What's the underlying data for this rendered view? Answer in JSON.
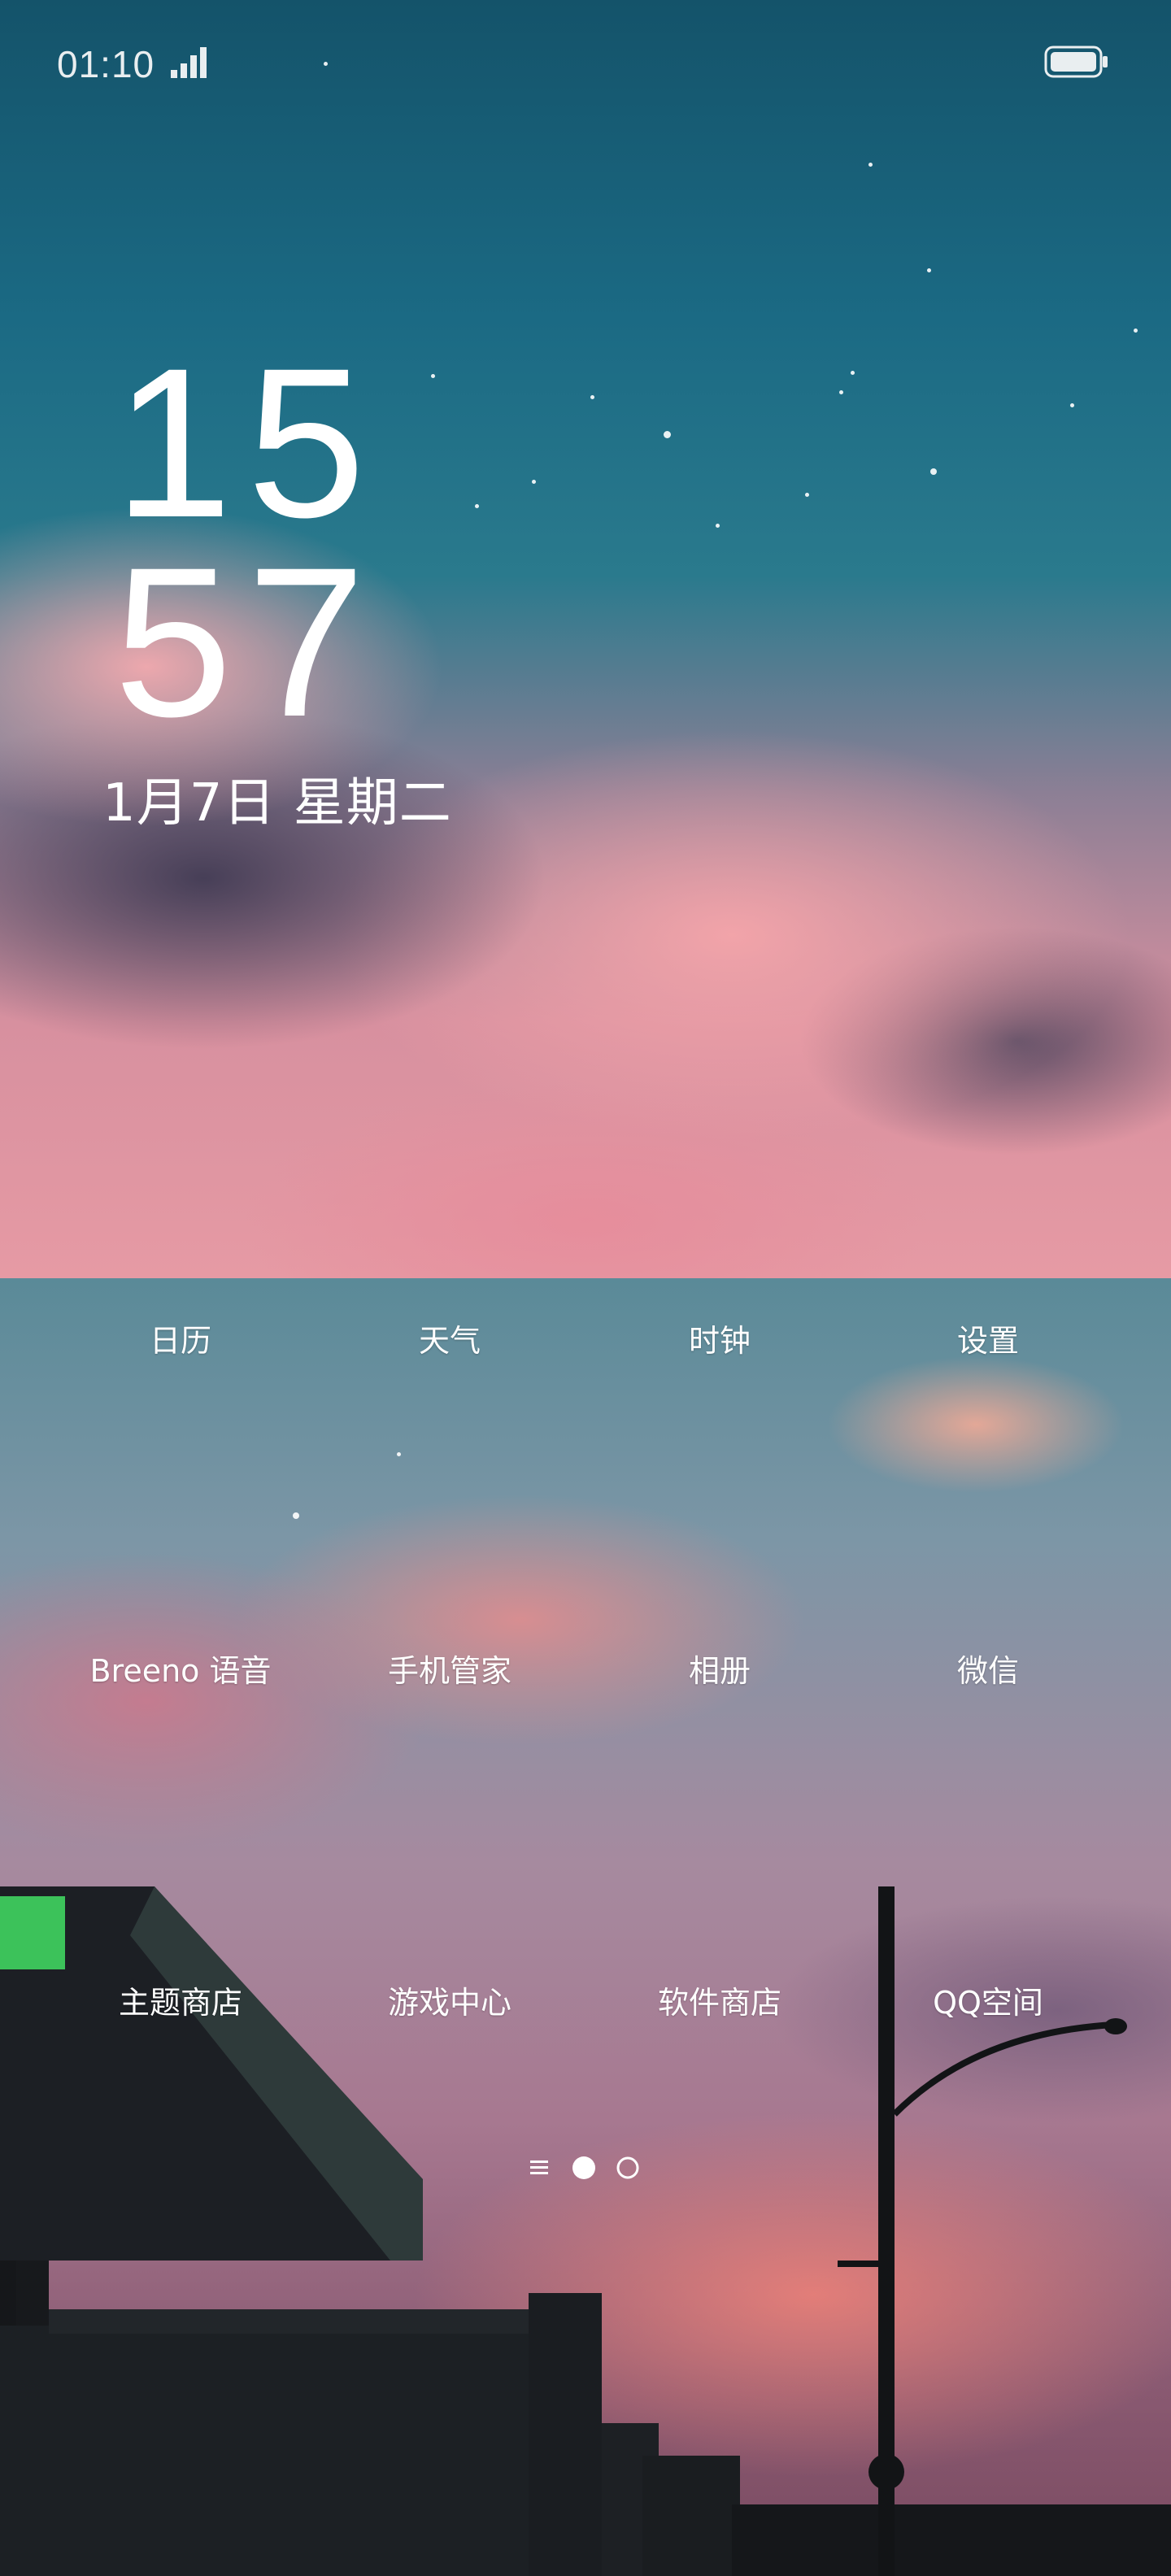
{
  "status_bar": {
    "time": "01:10",
    "signal_icon": "signal-bars-icon",
    "battery_icon": "battery-full-icon"
  },
  "clock": {
    "hours": "15",
    "minutes": "57",
    "date": "1月7日 星期二"
  },
  "apps": [
    {
      "label": "日历"
    },
    {
      "label": "天气"
    },
    {
      "label": "时钟"
    },
    {
      "label": "设置"
    },
    {
      "label": "Breeno 语音"
    },
    {
      "label": "手机管家"
    },
    {
      "label": "相册"
    },
    {
      "label": "微信"
    },
    {
      "label": "主题商店"
    },
    {
      "label": "游戏中心"
    },
    {
      "label": "软件商店"
    },
    {
      "label": "QQ空间"
    }
  ],
  "page_indicator": {
    "pages": 2,
    "current_page": 1,
    "icon": "app-drawer-icon"
  },
  "colors": {
    "sky_top": "#14536a",
    "cloud_pink": "#e69aa4",
    "text": "#ffffff"
  }
}
